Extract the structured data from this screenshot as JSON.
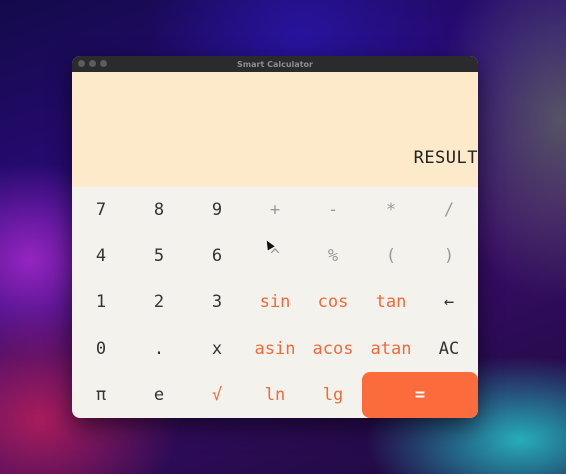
{
  "window": {
    "title": "Smart Calculator"
  },
  "display": {
    "text": "RESULT"
  },
  "keys": {
    "r1": [
      "7",
      "8",
      "9",
      "+",
      "-",
      "*",
      "/"
    ],
    "r2": [
      "4",
      "5",
      "6",
      "^",
      "%",
      "(",
      ")"
    ],
    "r3": [
      "1",
      "2",
      "3",
      "sin",
      "cos",
      "tan",
      "←"
    ],
    "r4": [
      "0",
      ".",
      "x",
      "asin",
      "acos",
      "atan",
      "AC"
    ],
    "r5": [
      "π",
      "e",
      "√",
      "ln",
      "lg",
      "="
    ]
  },
  "colors": {
    "display_bg": "#fdeacb",
    "keypad_bg": "#f4f2ed",
    "function_text": "#f26a3a",
    "equals_bg": "#fb6b3b"
  }
}
